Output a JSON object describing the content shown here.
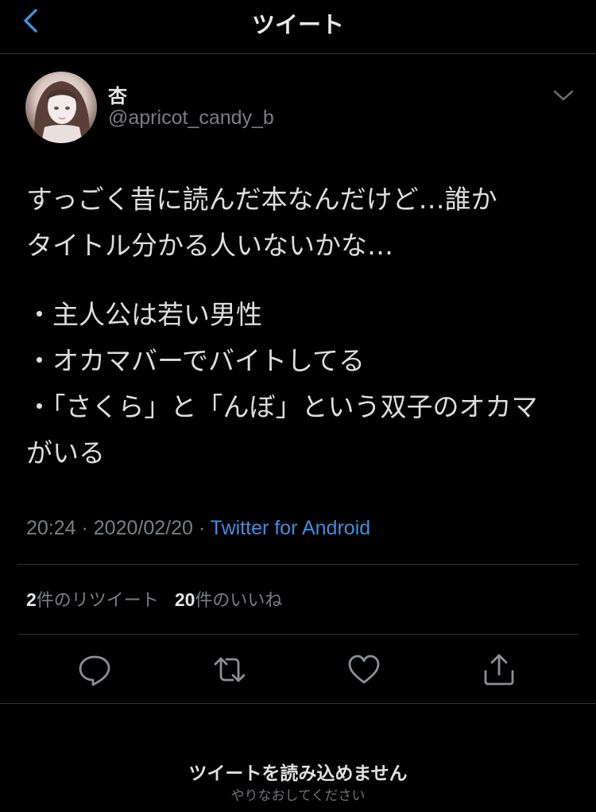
{
  "header": {
    "title": "ツイート",
    "back_icon": "chevron-left-icon",
    "accent_color": "#3f8fe0"
  },
  "tweet": {
    "author": {
      "display_name": "杏",
      "handle": "@apricot_candy_b"
    },
    "body": {
      "line1": "すっごく昔に読んだ本なんだけど…誰か",
      "line2": "タイトル分かる人いないかな…",
      "bullet1": "・主人公は若い男性",
      "bullet2": "・オカマバーでバイトしてる",
      "bullet3": "・「さくら」と「んぼ」という双子のオカマ",
      "bullet3_cont": "がいる"
    },
    "meta": {
      "timestamp": "20:24 · 2020/02/20 · ",
      "source": "Twitter for Android"
    },
    "stats": {
      "retweet_count": "2",
      "retweet_label": "件のリツイート",
      "like_count": "20",
      "like_label": "件のいいね"
    },
    "actions": [
      "reply-icon",
      "retweet-icon",
      "like-icon",
      "share-icon"
    ]
  },
  "error": {
    "title": "ツイートを読み込めません",
    "subtitle": "やりなおしてください"
  }
}
